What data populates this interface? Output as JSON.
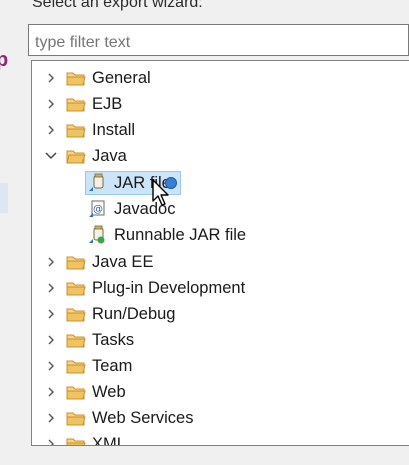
{
  "wizard": {
    "heading": "Select an export wizard:",
    "filter_placeholder": "type filter text"
  },
  "tree": {
    "items": [
      {
        "label": "General",
        "type": "folder",
        "expanded": false
      },
      {
        "label": "EJB",
        "type": "folder",
        "expanded": false
      },
      {
        "label": "Install",
        "type": "folder",
        "expanded": false
      },
      {
        "label": "Java",
        "type": "folder",
        "expanded": true
      },
      {
        "label": "JAR file",
        "type": "jar",
        "selected": true
      },
      {
        "label": "Javadoc",
        "type": "javadoc"
      },
      {
        "label": "Runnable JAR file",
        "type": "runnable-jar"
      },
      {
        "label": "Java EE",
        "type": "folder",
        "expanded": false
      },
      {
        "label": "Plug-in Development",
        "type": "folder",
        "expanded": false
      },
      {
        "label": "Run/Debug",
        "type": "folder",
        "expanded": false
      },
      {
        "label": "Tasks",
        "type": "folder",
        "expanded": false
      },
      {
        "label": "Team",
        "type": "folder",
        "expanded": false
      },
      {
        "label": "Web",
        "type": "folder",
        "expanded": false
      },
      {
        "label": "Web Services",
        "type": "folder",
        "expanded": false
      },
      {
        "label": "XML",
        "type": "folder",
        "expanded": false
      }
    ]
  },
  "colors": {
    "selection": "#cce4f7",
    "folder": "#e8b24a",
    "side_accent": "#8a2a7a"
  }
}
